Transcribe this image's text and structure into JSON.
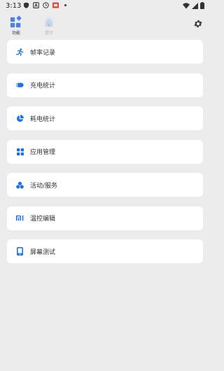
{
  "status_bar": {
    "time": "3:13"
  },
  "tabs": [
    {
      "label": "功能",
      "icon": "features-grid-icon",
      "active": true
    },
    {
      "label": "提示",
      "icon": "tips-house-icon",
      "active": false
    }
  ],
  "menu": [
    {
      "label": "帧率记录",
      "icon": "runner-icon"
    },
    {
      "label": "充电统计",
      "icon": "charging-plug-icon"
    },
    {
      "label": "耗电统计",
      "icon": "pie-chart-icon"
    },
    {
      "label": "应用管理",
      "icon": "app-grid-icon"
    },
    {
      "label": "活动/服务",
      "icon": "activity-circles-icon"
    },
    {
      "label": "温控编辑",
      "icon": "mi-logo-icon"
    },
    {
      "label": "屏幕测试",
      "icon": "phone-screen-icon"
    }
  ],
  "colors": {
    "accent": "#1a73e8",
    "background": "#ececec",
    "card": "#ffffff"
  }
}
